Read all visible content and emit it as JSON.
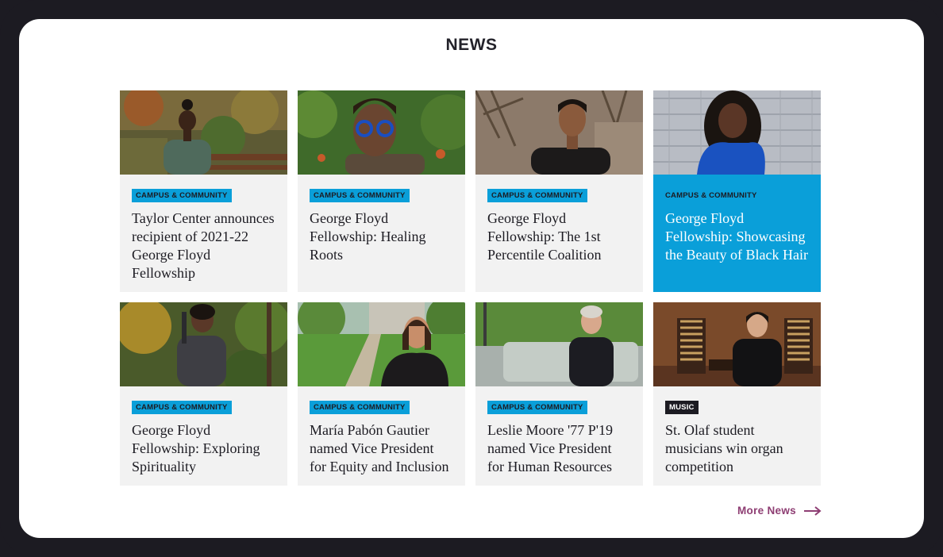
{
  "section": {
    "title": "NEWS"
  },
  "articles": [
    {
      "tag": "CAMPUS & COMMUNITY",
      "headline": "Taylor Center announces recipient of 2021-22 George Floyd Fellowship",
      "image": "woman-in-garden-photo"
    },
    {
      "tag": "CAMPUS & COMMUNITY",
      "headline": "George Floyd Fellowship: Healing Roots",
      "image": "person-blue-glasses-photo"
    },
    {
      "tag": "CAMPUS & COMMUNITY",
      "headline": "George Floyd Fellowship: The 1st Percentile Coalition",
      "image": "man-black-shirt-photo"
    },
    {
      "tag": "CAMPUS & COMMUNITY",
      "headline": "George Floyd Fellowship: Showcasing the Beauty of Black Hair",
      "image": "woman-blue-dress-photo"
    },
    {
      "tag": "CAMPUS & COMMUNITY",
      "headline": "George Floyd Fellowship: Exploring Spirituality",
      "image": "person-in-forest-photo"
    },
    {
      "tag": "CAMPUS & COMMUNITY",
      "headline": "María Pabón Gautier named Vice President for Equity and Inclusion",
      "image": "woman-on-campus-path-photo"
    },
    {
      "tag": "CAMPUS & COMMUNITY",
      "headline": "Leslie Moore '77 P'19 named Vice President for Human Resources",
      "image": "woman-on-sofa-photo"
    },
    {
      "tag": "MUSIC",
      "headline": "St. Olaf student musicians win organ competition",
      "image": "student-at-organ-photo"
    }
  ],
  "more_link": {
    "label": "More News"
  },
  "colors": {
    "accent": "#0a9fd9",
    "link": "#8e3e73",
    "frame": "#1c1b22",
    "card": "#f2f2f2"
  }
}
